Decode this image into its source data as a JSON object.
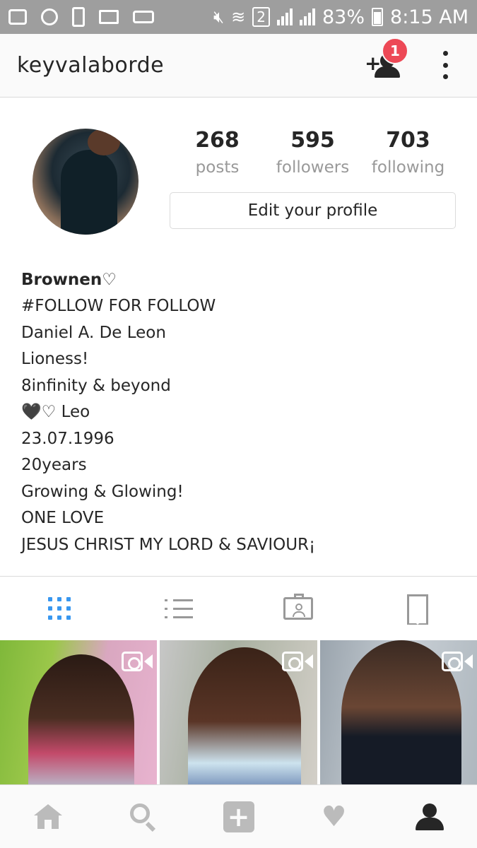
{
  "status_bar": {
    "sim": "2",
    "battery": "83%",
    "time": "8:15 AM"
  },
  "header": {
    "username": "keyvalaborde",
    "notification_count": "1"
  },
  "profile": {
    "stats": [
      {
        "value": "268",
        "label": "posts"
      },
      {
        "value": "595",
        "label": "followers"
      },
      {
        "value": "703",
        "label": "following"
      }
    ],
    "edit_button": "Edit your profile"
  },
  "bio": {
    "name": "Brownen♡",
    "lines": [
      "#FOLLOW FOR FOLLOW",
      "Daniel A. De Leon",
      "Lioness!",
      "8infinity & beyond",
      "🖤♡ Leo",
      "23.07.1996",
      "20years",
      "Growing & Glowing!",
      "ONE LOVE",
      "JESUS CHRIST MY LORD & SAVIOUR¡"
    ]
  },
  "profile_tabs": [
    "grid-icon",
    "list-icon",
    "tagged-photos-icon",
    "saved-bookmark-icon"
  ],
  "posts": [
    {
      "type": "video"
    },
    {
      "type": "video"
    },
    {
      "type": "video"
    }
  ],
  "bottom_nav": [
    "home-icon",
    "search-icon",
    "add-post-icon",
    "activity-heart-icon",
    "profile-icon"
  ],
  "colors": {
    "accent": "#3897f0",
    "badge": "#ed4956",
    "status_bar": "#9e9e9e"
  }
}
